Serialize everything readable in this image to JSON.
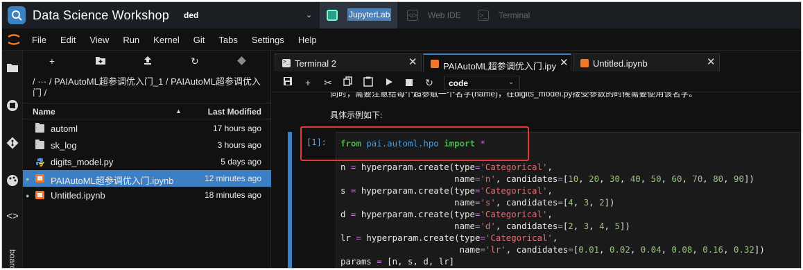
{
  "header": {
    "brand_title": "Data Science Workshop",
    "workspace": "ded",
    "tabs": [
      {
        "label": "JupyterLab",
        "active": true
      },
      {
        "label": "Web IDE",
        "active": false
      },
      {
        "label": "Terminal",
        "active": false
      }
    ]
  },
  "menu": [
    "File",
    "Edit",
    "View",
    "Run",
    "Kernel",
    "Git",
    "Tabs",
    "Settings",
    "Help"
  ],
  "activity_bar": {
    "icons": [
      "folder-icon",
      "running-icon",
      "git-icon",
      "palette-icon",
      "code-icon"
    ],
    "label": "boards"
  },
  "filebrowser": {
    "breadcrumb": "/ ··· / PAIAutoML超参调优入门_1 / PAIAutoML超参调优入门 /",
    "columns": {
      "name": "Name",
      "modified": "Last Modified"
    },
    "files": [
      {
        "name": "automl",
        "modified": "17 hours ago",
        "type": "folder",
        "running": false,
        "selected": false
      },
      {
        "name": "sk_log",
        "modified": "3 hours ago",
        "type": "folder",
        "running": false,
        "selected": false
      },
      {
        "name": "digits_model.py",
        "modified": "5 days ago",
        "type": "python",
        "running": false,
        "selected": false
      },
      {
        "name": "PAIAutoML超参调优入门.ipynb",
        "modified": "12 minutes ago",
        "type": "notebook",
        "running": true,
        "selected": true
      },
      {
        "name": "Untitled.ipynb",
        "modified": "18 minutes ago",
        "type": "notebook",
        "running": true,
        "selected": false
      }
    ]
  },
  "doc_tabs": [
    {
      "label": "Terminal 2",
      "icon": "terminal-icon",
      "active": false
    },
    {
      "label": "PAIAutoML超参调优入门.ipy",
      "icon": "notebook-icon",
      "active": true
    },
    {
      "label": "Untitled.ipynb",
      "icon": "notebook-icon",
      "active": false
    }
  ],
  "notebook_toolbar": {
    "cell_type": "code"
  },
  "notebook": {
    "markdown_cut": "同时，需要注意给每个超参赋一个名字(name)，在digits_model.py接受参数的时候需要使用该名字。",
    "markdown_text": "具体示例如下:",
    "cell_prompt": "[1]:",
    "code_lines": [
      "from pai.automl.hpo import *",
      "",
      "n = hyperparam.create(type='Categorical',",
      "                      name='n', candidates=[10, 20, 30, 40, 50, 60, 70, 80, 90])",
      "s = hyperparam.create(type='Categorical',",
      "                      name='s', candidates=[4, 3, 2])",
      "d = hyperparam.create(type='Categorical',",
      "                      name='d', candidates=[2, 3, 4, 5])",
      "lr = hyperparam.create(type='Categorical',",
      "                       name='lr', candidates=[0.01, 0.02, 0.04, 0.08, 0.16, 0.32])",
      "params = [n, s, d, lr]"
    ]
  },
  "colors": {
    "accent": "#3d7fc4",
    "jupyter_orange": "#f37726",
    "highlight_red": "#e53935"
  }
}
